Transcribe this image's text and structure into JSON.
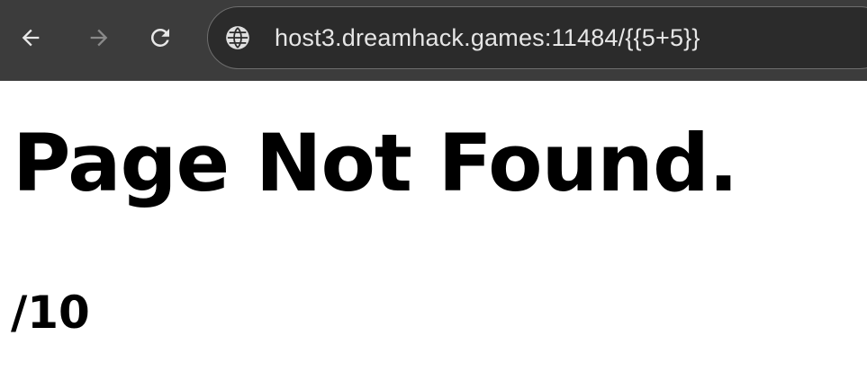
{
  "browser": {
    "url": "host3.dreamhack.games:11484/{{5+5}}",
    "icons": {
      "back": "arrow-left-icon",
      "forward": "arrow-right-icon",
      "reload": "reload-icon",
      "site": "globe-icon"
    },
    "colors": {
      "toolbar": "#3c3c3c",
      "omnibox": "#2b2b2b",
      "url_text": "#e6e6e6",
      "forward_disabled": "#8a8a8a"
    }
  },
  "page": {
    "heading": "Page Not Found.",
    "path": "/10"
  }
}
